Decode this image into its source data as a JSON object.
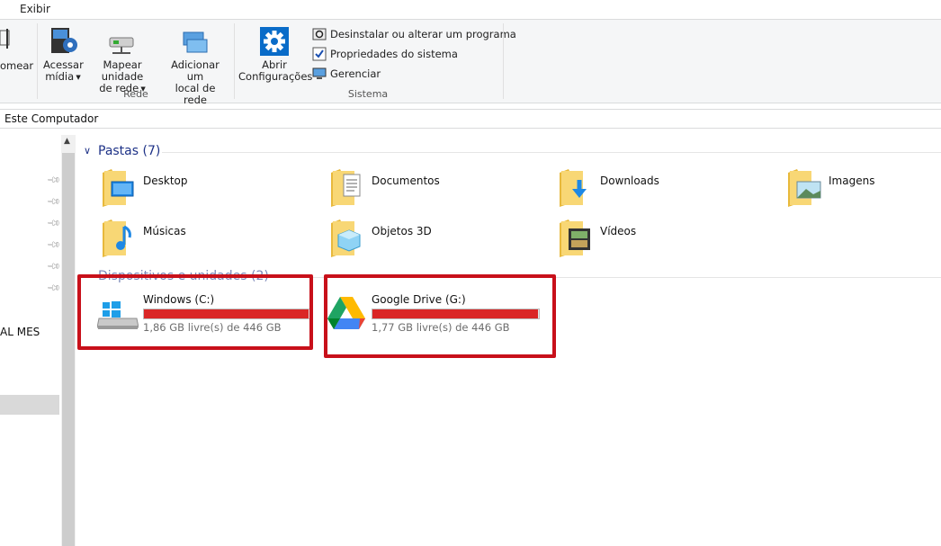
{
  "ribbon": {
    "tab_view": "Exibir",
    "rename_partial": "omear",
    "access_media": [
      "Acessar",
      "mídia"
    ],
    "map_drive": [
      "Mapear unidade",
      "de rede"
    ],
    "add_location": [
      "Adicionar um",
      "local de rede"
    ],
    "group_network": "Rede",
    "open_settings": [
      "Abrir",
      "Configurações"
    ],
    "uninstall": "Desinstalar ou alterar um programa",
    "system_props": "Propriedades do sistema",
    "manage": "Gerenciar",
    "group_system": "Sistema"
  },
  "address": {
    "path": "Este Computador"
  },
  "nav": {
    "partial_item": "AL MES"
  },
  "folders": {
    "header": "Pastas (7)",
    "items": [
      {
        "label": "Desktop",
        "icon": "desktop-folder-icon"
      },
      {
        "label": "Documentos",
        "icon": "documents-folder-icon"
      },
      {
        "label": "Downloads",
        "icon": "downloads-folder-icon"
      },
      {
        "label": "Imagens",
        "icon": "pictures-folder-icon"
      },
      {
        "label": "Músicas",
        "icon": "music-folder-icon"
      },
      {
        "label": "Objetos 3D",
        "icon": "3d-objects-folder-icon"
      },
      {
        "label": "Vídeos",
        "icon": "videos-folder-icon"
      }
    ]
  },
  "devices": {
    "header": "Dispositivos e unidades (2)",
    "drives": [
      {
        "name": "Windows (C:)",
        "free": "1,86 GB livre(s) de 446 GB",
        "used_fraction": 0.996
      },
      {
        "name": "Google Drive (G:)",
        "free": "1,77 GB livre(s) de 446 GB",
        "used_fraction": 0.996
      }
    ]
  },
  "colors": {
    "highlight_box": "#c8101a",
    "drive_bar_full": "#da2626",
    "section_header": "#1e3287",
    "folder_yellow": "#f8d775"
  }
}
